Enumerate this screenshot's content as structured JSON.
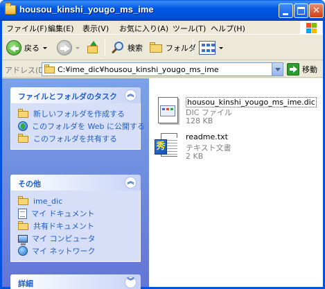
{
  "window": {
    "title": "housou_kinshi_yougo_ms_ime"
  },
  "menu": [
    "ファイル(F)",
    "編集(E)",
    "表示(V)",
    "お気に入り(A)",
    "ツール(T)",
    "ヘルプ(H)"
  ],
  "toolbar": {
    "back_label": "戻る",
    "search_label": "検索",
    "folders_label": "フォルダ"
  },
  "address": {
    "label": "アドレス(D)",
    "path": "C:¥ime_dic¥housou_kinshi_yougo_ms_ime",
    "go_label": "移動"
  },
  "tasks_panel": {
    "title": "ファイルとフォルダのタスク",
    "items": [
      {
        "label": "新しいフォルダを作成する",
        "icon": "new-folder-icon"
      },
      {
        "label": "このフォルダを Web に公開する",
        "icon": "globe-icon"
      },
      {
        "label": "このフォルダを共有する",
        "icon": "share-folder-icon"
      }
    ]
  },
  "other_panel": {
    "title": "その他",
    "items": [
      {
        "label": "ime_dic",
        "icon": "folder-icon"
      },
      {
        "label": "マイ ドキュメント",
        "icon": "documents-icon"
      },
      {
        "label": "共有ドキュメント",
        "icon": "folder-icon"
      },
      {
        "label": "マイ コンピュータ",
        "icon": "computer-icon"
      },
      {
        "label": "マイ ネットワーク",
        "icon": "network-icon"
      }
    ]
  },
  "details_panel": {
    "title": "詳細"
  },
  "files": [
    {
      "name": "housou_kinshi_yougo_ms_ime.dic",
      "type": "DIC ファイル",
      "size": "128 KB",
      "icon": "dic-file-icon",
      "selected": true
    },
    {
      "name": "readme.txt",
      "type": "テキスト文書",
      "size": "2 KB",
      "icon": "text-file-icon",
      "selected": false
    }
  ],
  "colors": {
    "titlebar": "#0058e6",
    "taskpane": "#7ba2e7",
    "link": "#215dc6"
  }
}
